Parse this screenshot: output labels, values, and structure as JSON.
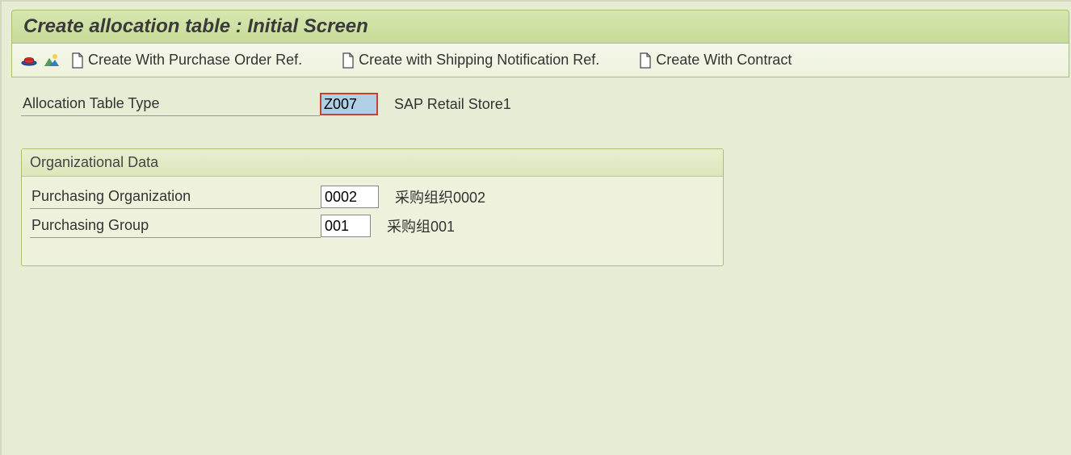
{
  "header": {
    "title": "Create allocation table : Initial Screen"
  },
  "toolbar": {
    "btn_po_ref": "Create With Purchase Order Ref.",
    "btn_ship_ref": "Create with Shipping Notification Ref.",
    "btn_contract_ref": "Create With Contract"
  },
  "fields": {
    "alloc_type": {
      "label": "Allocation Table Type",
      "value": "Z007",
      "desc": "SAP Retail Store1"
    }
  },
  "org_data": {
    "title": "Organizational Data",
    "purch_org": {
      "label": "Purchasing Organization",
      "value": "0002",
      "desc": "采购组织0002"
    },
    "purch_group": {
      "label": "Purchasing Group",
      "value": "001",
      "desc": "采购组001"
    }
  }
}
